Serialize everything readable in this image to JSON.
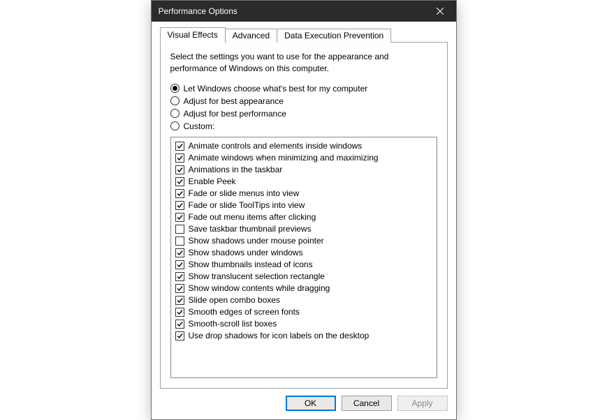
{
  "window": {
    "title": "Performance Options"
  },
  "tabs": [
    {
      "label": "Visual Effects",
      "active": true
    },
    {
      "label": "Advanced",
      "active": false
    },
    {
      "label": "Data Execution Prevention",
      "active": false
    }
  ],
  "intro": "Select the settings you want to use for the appearance and performance of Windows on this computer.",
  "radios": [
    {
      "label": "Let Windows choose what's best for my computer",
      "checked": true
    },
    {
      "label": "Adjust for best appearance",
      "checked": false
    },
    {
      "label": "Adjust for best performance",
      "checked": false
    },
    {
      "label": "Custom:",
      "checked": false
    }
  ],
  "checkboxes": [
    {
      "label": "Animate controls and elements inside windows",
      "checked": true
    },
    {
      "label": "Animate windows when minimizing and maximizing",
      "checked": true
    },
    {
      "label": "Animations in the taskbar",
      "checked": true
    },
    {
      "label": "Enable Peek",
      "checked": true
    },
    {
      "label": "Fade or slide menus into view",
      "checked": true
    },
    {
      "label": "Fade or slide ToolTips into view",
      "checked": true
    },
    {
      "label": "Fade out menu items after clicking",
      "checked": true
    },
    {
      "label": "Save taskbar thumbnail previews",
      "checked": false
    },
    {
      "label": "Show shadows under mouse pointer",
      "checked": false
    },
    {
      "label": "Show shadows under windows",
      "checked": true
    },
    {
      "label": "Show thumbnails instead of icons",
      "checked": true
    },
    {
      "label": "Show translucent selection rectangle",
      "checked": true
    },
    {
      "label": "Show window contents while dragging",
      "checked": true
    },
    {
      "label": "Slide open combo boxes",
      "checked": true
    },
    {
      "label": "Smooth edges of screen fonts",
      "checked": true
    },
    {
      "label": "Smooth-scroll list boxes",
      "checked": true
    },
    {
      "label": "Use drop shadows for icon labels on the desktop",
      "checked": true
    }
  ],
  "buttons": {
    "ok": "OK",
    "cancel": "Cancel",
    "apply": "Apply"
  }
}
